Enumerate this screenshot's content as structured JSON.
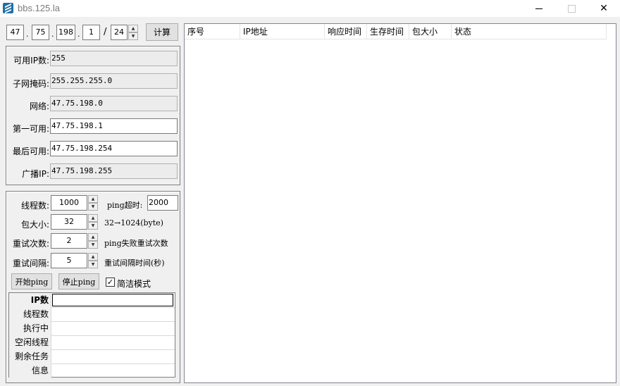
{
  "window": {
    "title": "bbs.125.la",
    "controls": {
      "minimize": "",
      "maximize": "",
      "close": "✕"
    }
  },
  "ip_input": {
    "octets": [
      "47",
      "75",
      "198",
      "1"
    ],
    "separator": ".",
    "slash": "/",
    "prefix": "24",
    "calc_button": "计算"
  },
  "subnet_info": {
    "rows": [
      {
        "label": "可用IP数:",
        "value": "255",
        "readonly": true
      },
      {
        "label": "子网掩码:",
        "value": "255.255.255.0",
        "readonly": true
      },
      {
        "label": "网络:",
        "value": "47.75.198.0",
        "readonly": true
      },
      {
        "label": "第一可用:",
        "value": "47.75.198.1",
        "readonly": false
      },
      {
        "label": "最后可用:",
        "value": "47.75.198.254",
        "readonly": false
      },
      {
        "label": "广播IP:",
        "value": "47.75.198.255",
        "readonly": true
      }
    ]
  },
  "ping_settings": {
    "threads": {
      "label": "线程数:",
      "value": "1000"
    },
    "timeout": {
      "label": "ping超时:",
      "value": "2000"
    },
    "packet_size": {
      "label": "包大小:",
      "value": "32",
      "hint": "32→1024(byte)"
    },
    "retries": {
      "label": "重试次数:",
      "value": "2",
      "hint": "ping失败重试次数"
    },
    "interval": {
      "label": "重试间隔:",
      "value": "5",
      "hint": "重试间隔时间(秒)"
    },
    "start_button": "开始ping",
    "stop_button": "停止ping",
    "simple_mode": {
      "label": "简洁模式",
      "checked": "✓"
    }
  },
  "stats": {
    "rows": [
      {
        "label": "IP数",
        "value": ""
      },
      {
        "label": "线程数",
        "value": ""
      },
      {
        "label": "执行中",
        "value": ""
      },
      {
        "label": "空闲线程",
        "value": ""
      },
      {
        "label": "剩余任务",
        "value": ""
      },
      {
        "label": "信息",
        "value": ""
      }
    ]
  },
  "results_table": {
    "columns": [
      "序号",
      "IP地址",
      "响应时间",
      "生存时间",
      "包大小",
      "状态"
    ],
    "rows": []
  }
}
